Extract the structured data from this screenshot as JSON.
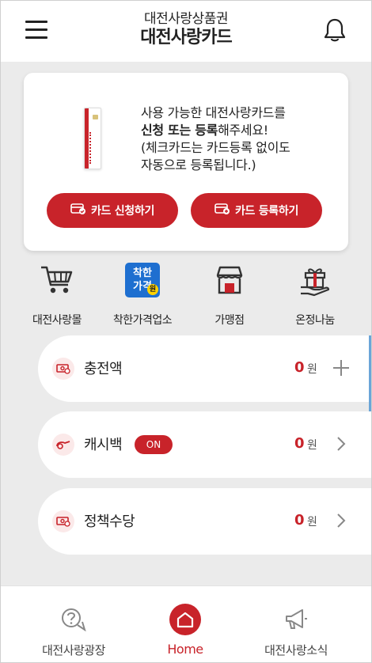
{
  "header": {
    "subtitle": "대전사랑상품권",
    "title": "대전사랑카드"
  },
  "card_promo": {
    "line1": "사용 가능한 대전사랑카드를",
    "line2_bold": "신청 또는 등록",
    "line2_rest": "해주세요!",
    "line3": "(체크카드는 카드등록 없이도",
    "line4": "자동으로 등록됩니다.)",
    "apply_button": "카드 신청하기",
    "register_button": "카드 등록하기"
  },
  "quick_menu": [
    {
      "label": "대전사랑몰",
      "icon": "shopping-cart-icon"
    },
    {
      "label": "착한가격업소",
      "icon": "good-price-icon",
      "icon_text_1": "착한",
      "icon_text_2": "가격",
      "icon_badge": "원"
    },
    {
      "label": "가맹점",
      "icon": "store-icon"
    },
    {
      "label": "온정나눔",
      "icon": "gift-icon"
    }
  ],
  "balances": [
    {
      "label": "충전액",
      "amount": "0",
      "unit": "원",
      "action": "plus-icon"
    },
    {
      "label": "캐시백",
      "badge": "ON",
      "amount": "0",
      "unit": "원",
      "action": "chevron-right-icon"
    },
    {
      "label": "정책수당",
      "amount": "0",
      "unit": "원",
      "action": "chevron-right-icon"
    }
  ],
  "bottom_nav": [
    {
      "label": "대전사랑광장",
      "icon": "question-chat-icon"
    },
    {
      "label": "Home",
      "icon": "home-icon",
      "active": true
    },
    {
      "label": "대전사랑소식",
      "icon": "megaphone-icon"
    }
  ],
  "colors": {
    "brand_red": "#c8232a",
    "background": "#ebebeb",
    "good_price_blue": "#1e6fd0"
  }
}
